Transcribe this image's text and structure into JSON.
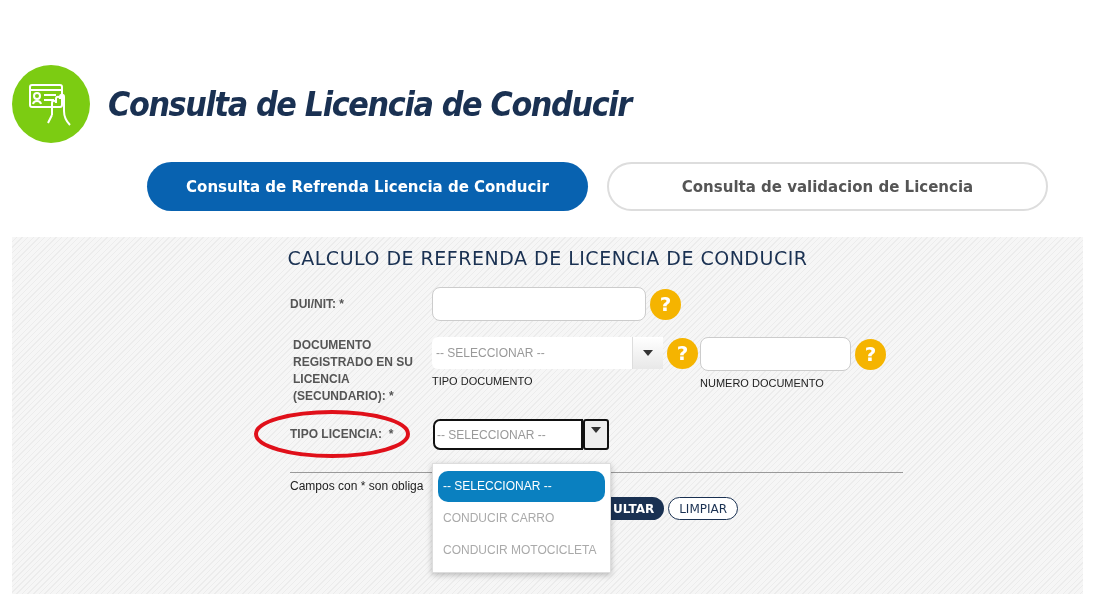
{
  "header": {
    "title": "Consulta de Licencia de Conducir"
  },
  "tabs": [
    {
      "label": "Consulta de Refrenda Licencia de Conducir",
      "selected": true
    },
    {
      "label": "Consulta de validacion de Licencia",
      "selected": false
    }
  ],
  "form": {
    "heading": "CALCULO DE REFRENDA DE LICENCIA DE CONDUCIR",
    "dui_label": "DUI/NIT: *",
    "doc_label": "DOCUMENTO REGISTRADO EN SU LICENCIA (SECUNDARIO): *",
    "doc_type_placeholder": "-- SELECCIONAR --",
    "doc_type_caption": "TIPO DOCUMENTO",
    "doc_number_caption": "NUMERO DOCUMENTO",
    "license_label": "TIPO LICENCIA:  *",
    "license_placeholder": "-- SELECCIONAR --",
    "help": [
      "?",
      "?",
      "?"
    ],
    "note": "Campos con * son obliga",
    "buttons": [
      {
        "label": "ULTAR",
        "kind": "primary"
      },
      {
        "label": "LIMPIAR",
        "kind": "outline"
      }
    ]
  },
  "dropdown": {
    "options": [
      {
        "label": "-- SELECCIONAR --",
        "selected": true
      },
      {
        "label": "CONDUCIR CARRO",
        "selected": false
      },
      {
        "label": "CONDUCIR MOTOCICLETA",
        "selected": false
      }
    ]
  }
}
